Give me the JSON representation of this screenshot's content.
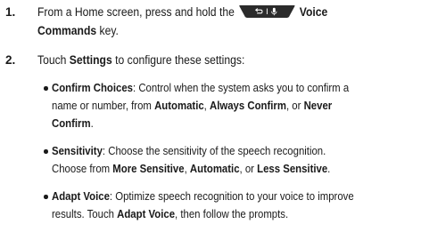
{
  "steps": [
    {
      "number": "1.",
      "line1_pre": "From a Home screen, press and hold the",
      "key_icon": "voice-commands-key-icon",
      "key_label_bold": "Voice",
      "line2_bold": "Commands",
      "line2_post": " key."
    },
    {
      "number": "2.",
      "pre": "Touch ",
      "bold": "Settings",
      "post": " to configure these settings:"
    }
  ],
  "bullets": [
    {
      "title": "Confirm Choices",
      "l1_text": ": Control when the system asks you to confirm a",
      "l2_pre": "name or number, from ",
      "l2_b1": "Automatic",
      "l2_mid1": ", ",
      "l2_b2": "Always Confirm",
      "l2_mid2": ", or ",
      "l2_b3": "Never",
      "l3_b": "Confirm",
      "l3_post": "."
    },
    {
      "title": "Sensitivity",
      "l1_text": ": Choose the sensitivity of the speech recognition.",
      "l2_pre": "Choose from ",
      "l2_b1": "More Sensitive",
      "l2_mid1": ", ",
      "l2_b2": "Automatic",
      "l2_mid2": ", or ",
      "l2_b3": "Less Sensitive",
      "l2_post": "."
    },
    {
      "title": "Adapt Voice",
      "l1_text": ": Optimize speech recognition to your voice to improve",
      "l2_pre": "results. Touch ",
      "l2_b1": "Adapt Voice",
      "l2_post": ", then follow the prompts."
    }
  ],
  "colors": {
    "text": "#1a1a1a",
    "key_fill": "#2b2b2b",
    "key_glyph": "#ffffff"
  }
}
